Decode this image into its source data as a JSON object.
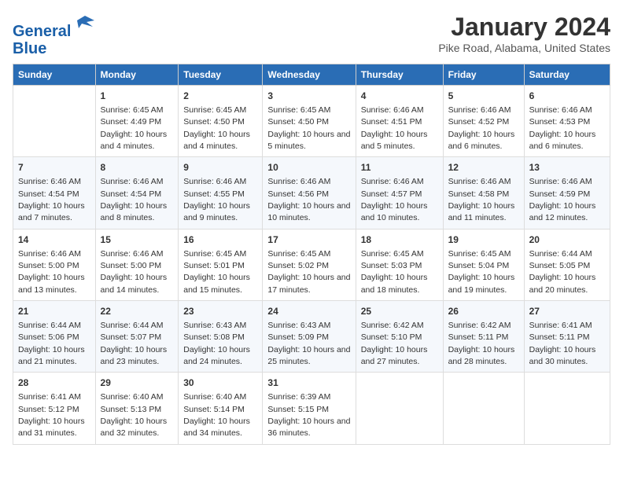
{
  "header": {
    "logo_line1": "General",
    "logo_line2": "Blue",
    "title": "January 2024",
    "subtitle": "Pike Road, Alabama, United States"
  },
  "weekdays": [
    "Sunday",
    "Monday",
    "Tuesday",
    "Wednesday",
    "Thursday",
    "Friday",
    "Saturday"
  ],
  "weeks": [
    [
      {
        "day": "",
        "sunrise": "",
        "sunset": "",
        "daylight": ""
      },
      {
        "day": "1",
        "sunrise": "Sunrise: 6:45 AM",
        "sunset": "Sunset: 4:49 PM",
        "daylight": "Daylight: 10 hours and 4 minutes."
      },
      {
        "day": "2",
        "sunrise": "Sunrise: 6:45 AM",
        "sunset": "Sunset: 4:50 PM",
        "daylight": "Daylight: 10 hours and 4 minutes."
      },
      {
        "day": "3",
        "sunrise": "Sunrise: 6:45 AM",
        "sunset": "Sunset: 4:50 PM",
        "daylight": "Daylight: 10 hours and 5 minutes."
      },
      {
        "day": "4",
        "sunrise": "Sunrise: 6:46 AM",
        "sunset": "Sunset: 4:51 PM",
        "daylight": "Daylight: 10 hours and 5 minutes."
      },
      {
        "day": "5",
        "sunrise": "Sunrise: 6:46 AM",
        "sunset": "Sunset: 4:52 PM",
        "daylight": "Daylight: 10 hours and 6 minutes."
      },
      {
        "day": "6",
        "sunrise": "Sunrise: 6:46 AM",
        "sunset": "Sunset: 4:53 PM",
        "daylight": "Daylight: 10 hours and 6 minutes."
      }
    ],
    [
      {
        "day": "7",
        "sunrise": "Sunrise: 6:46 AM",
        "sunset": "Sunset: 4:54 PM",
        "daylight": "Daylight: 10 hours and 7 minutes."
      },
      {
        "day": "8",
        "sunrise": "Sunrise: 6:46 AM",
        "sunset": "Sunset: 4:54 PM",
        "daylight": "Daylight: 10 hours and 8 minutes."
      },
      {
        "day": "9",
        "sunrise": "Sunrise: 6:46 AM",
        "sunset": "Sunset: 4:55 PM",
        "daylight": "Daylight: 10 hours and 9 minutes."
      },
      {
        "day": "10",
        "sunrise": "Sunrise: 6:46 AM",
        "sunset": "Sunset: 4:56 PM",
        "daylight": "Daylight: 10 hours and 10 minutes."
      },
      {
        "day": "11",
        "sunrise": "Sunrise: 6:46 AM",
        "sunset": "Sunset: 4:57 PM",
        "daylight": "Daylight: 10 hours and 10 minutes."
      },
      {
        "day": "12",
        "sunrise": "Sunrise: 6:46 AM",
        "sunset": "Sunset: 4:58 PM",
        "daylight": "Daylight: 10 hours and 11 minutes."
      },
      {
        "day": "13",
        "sunrise": "Sunrise: 6:46 AM",
        "sunset": "Sunset: 4:59 PM",
        "daylight": "Daylight: 10 hours and 12 minutes."
      }
    ],
    [
      {
        "day": "14",
        "sunrise": "Sunrise: 6:46 AM",
        "sunset": "Sunset: 5:00 PM",
        "daylight": "Daylight: 10 hours and 13 minutes."
      },
      {
        "day": "15",
        "sunrise": "Sunrise: 6:46 AM",
        "sunset": "Sunset: 5:00 PM",
        "daylight": "Daylight: 10 hours and 14 minutes."
      },
      {
        "day": "16",
        "sunrise": "Sunrise: 6:45 AM",
        "sunset": "Sunset: 5:01 PM",
        "daylight": "Daylight: 10 hours and 15 minutes."
      },
      {
        "day": "17",
        "sunrise": "Sunrise: 6:45 AM",
        "sunset": "Sunset: 5:02 PM",
        "daylight": "Daylight: 10 hours and 17 minutes."
      },
      {
        "day": "18",
        "sunrise": "Sunrise: 6:45 AM",
        "sunset": "Sunset: 5:03 PM",
        "daylight": "Daylight: 10 hours and 18 minutes."
      },
      {
        "day": "19",
        "sunrise": "Sunrise: 6:45 AM",
        "sunset": "Sunset: 5:04 PM",
        "daylight": "Daylight: 10 hours and 19 minutes."
      },
      {
        "day": "20",
        "sunrise": "Sunrise: 6:44 AM",
        "sunset": "Sunset: 5:05 PM",
        "daylight": "Daylight: 10 hours and 20 minutes."
      }
    ],
    [
      {
        "day": "21",
        "sunrise": "Sunrise: 6:44 AM",
        "sunset": "Sunset: 5:06 PM",
        "daylight": "Daylight: 10 hours and 21 minutes."
      },
      {
        "day": "22",
        "sunrise": "Sunrise: 6:44 AM",
        "sunset": "Sunset: 5:07 PM",
        "daylight": "Daylight: 10 hours and 23 minutes."
      },
      {
        "day": "23",
        "sunrise": "Sunrise: 6:43 AM",
        "sunset": "Sunset: 5:08 PM",
        "daylight": "Daylight: 10 hours and 24 minutes."
      },
      {
        "day": "24",
        "sunrise": "Sunrise: 6:43 AM",
        "sunset": "Sunset: 5:09 PM",
        "daylight": "Daylight: 10 hours and 25 minutes."
      },
      {
        "day": "25",
        "sunrise": "Sunrise: 6:42 AM",
        "sunset": "Sunset: 5:10 PM",
        "daylight": "Daylight: 10 hours and 27 minutes."
      },
      {
        "day": "26",
        "sunrise": "Sunrise: 6:42 AM",
        "sunset": "Sunset: 5:11 PM",
        "daylight": "Daylight: 10 hours and 28 minutes."
      },
      {
        "day": "27",
        "sunrise": "Sunrise: 6:41 AM",
        "sunset": "Sunset: 5:11 PM",
        "daylight": "Daylight: 10 hours and 30 minutes."
      }
    ],
    [
      {
        "day": "28",
        "sunrise": "Sunrise: 6:41 AM",
        "sunset": "Sunset: 5:12 PM",
        "daylight": "Daylight: 10 hours and 31 minutes."
      },
      {
        "day": "29",
        "sunrise": "Sunrise: 6:40 AM",
        "sunset": "Sunset: 5:13 PM",
        "daylight": "Daylight: 10 hours and 32 minutes."
      },
      {
        "day": "30",
        "sunrise": "Sunrise: 6:40 AM",
        "sunset": "Sunset: 5:14 PM",
        "daylight": "Daylight: 10 hours and 34 minutes."
      },
      {
        "day": "31",
        "sunrise": "Sunrise: 6:39 AM",
        "sunset": "Sunset: 5:15 PM",
        "daylight": "Daylight: 10 hours and 36 minutes."
      },
      {
        "day": "",
        "sunrise": "",
        "sunset": "",
        "daylight": ""
      },
      {
        "day": "",
        "sunrise": "",
        "sunset": "",
        "daylight": ""
      },
      {
        "day": "",
        "sunrise": "",
        "sunset": "",
        "daylight": ""
      }
    ]
  ]
}
